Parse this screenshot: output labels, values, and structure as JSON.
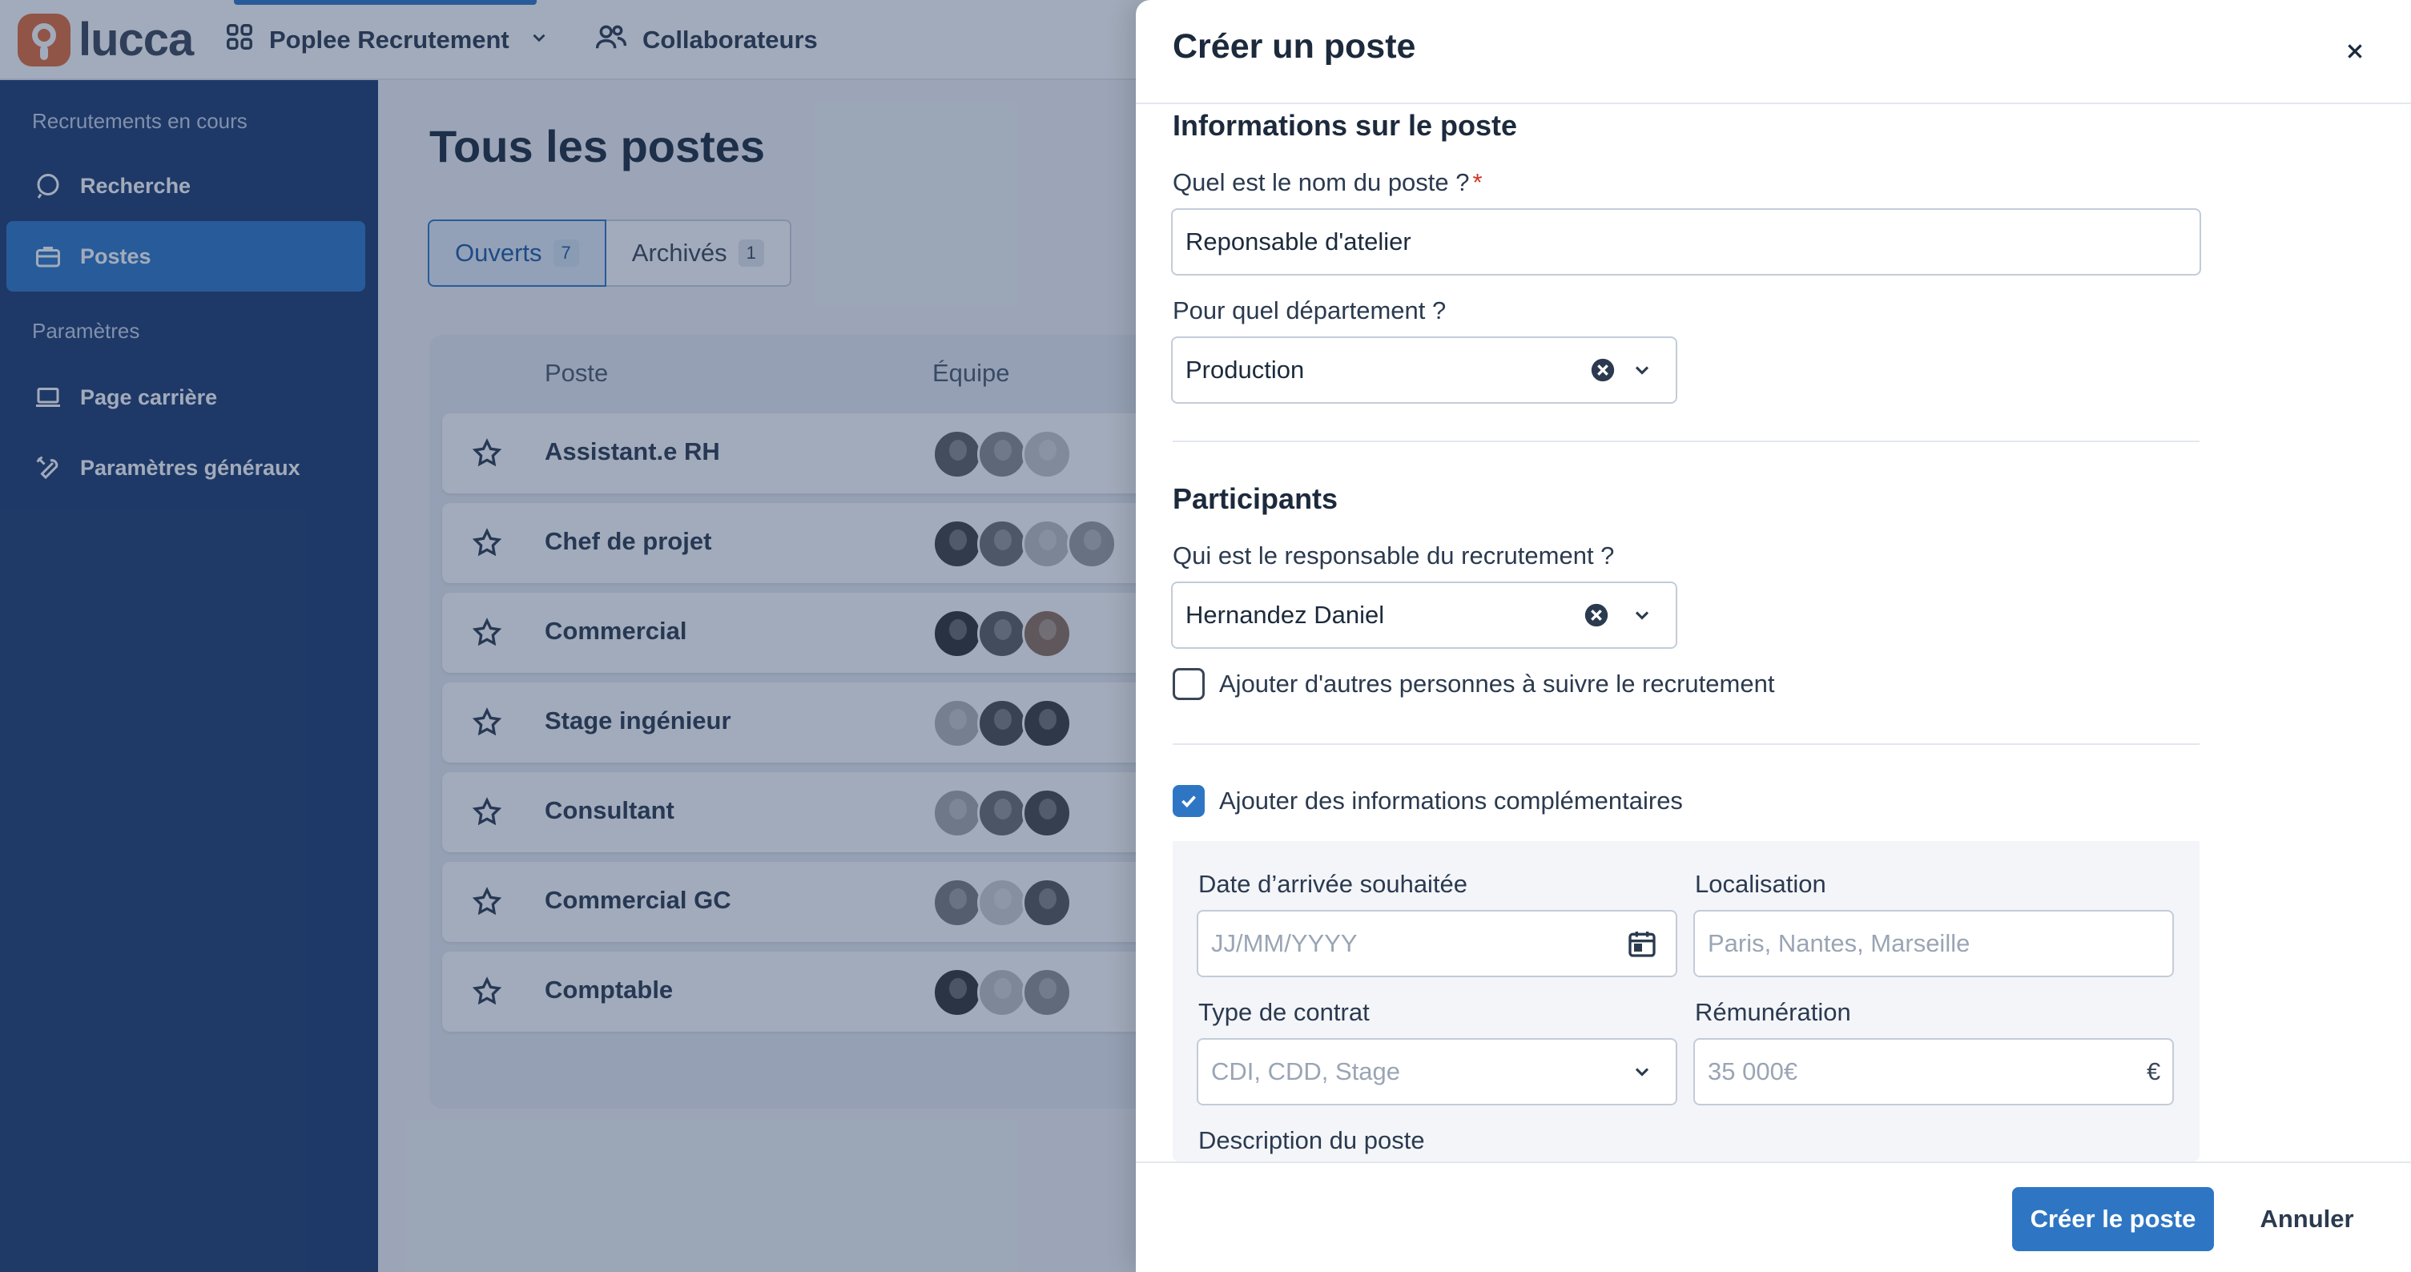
{
  "topbar": {
    "logo_text": "lucca",
    "app_switcher_label": "Poplee Recrutement",
    "collaborators_label": "Collaborateurs"
  },
  "sidebar": {
    "section_1": "Recrutements en cours",
    "section_2": "Paramètres",
    "items": [
      {
        "label": "Recherche",
        "icon": "search-icon"
      },
      {
        "label": "Postes",
        "icon": "briefcase-icon",
        "active": true
      },
      {
        "label": "Page carrière",
        "icon": "laptop-icon"
      },
      {
        "label": "Paramètres généraux",
        "icon": "tools-icon"
      }
    ]
  },
  "main": {
    "title": "Tous les postes",
    "tabs": [
      {
        "label": "Ouverts",
        "count": "7"
      },
      {
        "label": "Archivés",
        "count": "1"
      }
    ],
    "columns": [
      "Poste",
      "Équipe"
    ],
    "rows": [
      {
        "name": "Assistant.e RH"
      },
      {
        "name": "Chef de projet"
      },
      {
        "name": "Commercial"
      },
      {
        "name": "Stage ingénieur"
      },
      {
        "name": "Consultant"
      },
      {
        "name": "Commercial GC"
      },
      {
        "name": "Comptable"
      }
    ]
  },
  "drawer": {
    "title": "Créer un poste",
    "section_info": "Informations sur le poste",
    "job_name_label": "Quel est le nom du poste ?",
    "required_mark": "*",
    "job_name_value": "Reponsable d'atelier",
    "department_label": "Pour quel département ?",
    "department_value": "Production",
    "section_participants": "Participants",
    "owner_label": "Qui est le responsable du recrutement ?",
    "owner_value": "Hernandez Daniel",
    "add_followers_label": "Ajouter d'autres personnes à suivre le recrutement",
    "add_followers_checked": false,
    "add_extra_label": "Ajouter des informations complémentaires",
    "add_extra_checked": true,
    "arrival_date_label": "Date d’arrivée souhaitée",
    "arrival_date_placeholder": "JJ/MM/YYYY",
    "location_label": "Localisation",
    "location_placeholder": "Paris, Nantes, Marseille",
    "contract_label": "Type de contrat",
    "contract_placeholder": "CDI, CDD, Stage",
    "salary_label": "Rémunération",
    "salary_placeholder": "35 000€",
    "currency_symbol": "€",
    "description_label": "Description du poste",
    "submit_label": "Créer le poste",
    "cancel_label": "Annuler"
  },
  "colors": {
    "primary": "#2e76c4",
    "sidebar": "#1d3c6e",
    "overlay": "#22385c"
  }
}
